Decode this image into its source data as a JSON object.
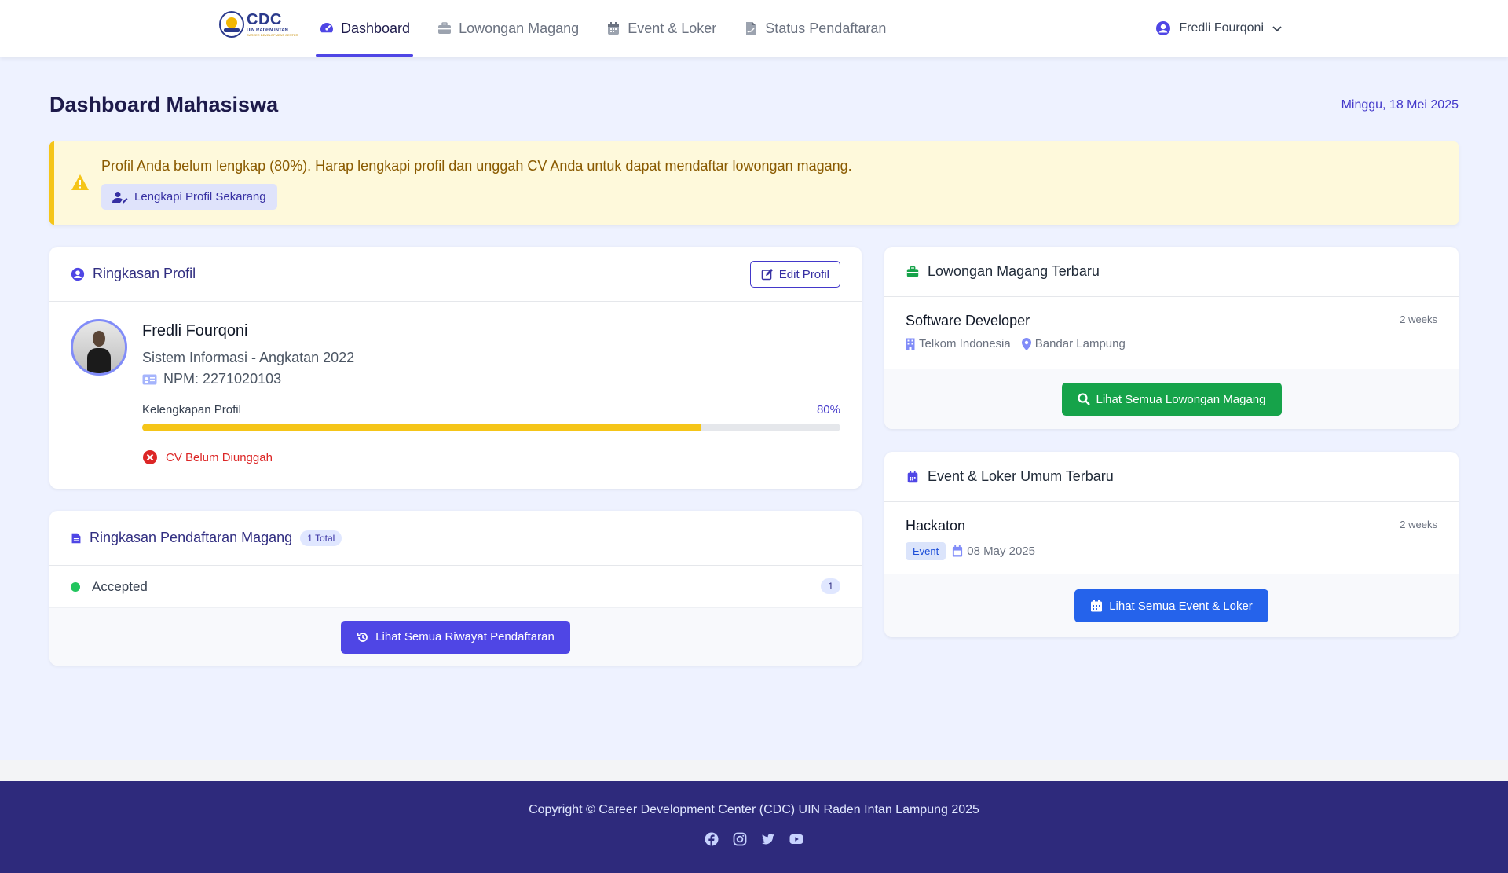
{
  "brand": {
    "name": "CDC",
    "sub": "UIN RADEN INTAN",
    "tagline": "CAREER DEVELOPMENT CENTER"
  },
  "nav": {
    "items": [
      {
        "label": "Dashboard",
        "icon": "gauge-icon",
        "active": true
      },
      {
        "label": "Lowongan Magang",
        "icon": "briefcase-icon"
      },
      {
        "label": "Event & Loker",
        "icon": "calendar-icon"
      },
      {
        "label": "Status Pendaftaran",
        "icon": "file-signature-icon"
      }
    ],
    "user": "Fredli Fourqoni"
  },
  "page": {
    "title": "Dashboard Mahasiswa",
    "date": "Minggu, 18 Mei 2025"
  },
  "alert": {
    "text": "Profil Anda belum lengkap (80%). Harap lengkapi profil dan unggah CV Anda untuk dapat mendaftar lowongan magang.",
    "button": "Lengkapi Profil Sekarang"
  },
  "profile": {
    "title": "Ringkasan Profil",
    "edit_label": "Edit Profil",
    "name": "Fredli Fourqoni",
    "program": "Sistem Informasi - Angkatan 2022",
    "npm": "NPM: 2271020103",
    "completeness_label": "Kelengkapan Profil",
    "completeness_text": "80%",
    "completeness": 0.8,
    "cv_status": "CV Belum Diunggah"
  },
  "registration": {
    "title": "Ringkasan Pendaftaran Magang",
    "total_badge": "1 Total",
    "rows": [
      {
        "label": "Accepted",
        "count": "1"
      }
    ],
    "button": "Lihat Semua Riwayat Pendaftaran"
  },
  "internships": {
    "title": "Lowongan Magang Terbaru",
    "items": [
      {
        "title": "Software Developer",
        "company": "Telkom Indonesia",
        "location": "Bandar Lampung",
        "time": "2 weeks"
      }
    ],
    "button": "Lihat Semua Lowongan Magang"
  },
  "events": {
    "title": "Event & Loker Umum Terbaru",
    "items": [
      {
        "title": "Hackaton",
        "tag": "Event",
        "date": "08 May 2025",
        "time": "2 weeks"
      }
    ],
    "button": "Lihat Semua Event & Loker"
  },
  "footer": {
    "copyright": "Copyright © Career Development Center (CDC) UIN Raden Intan Lampung 2025",
    "socials": [
      "facebook-icon",
      "instagram-icon",
      "twitter-icon",
      "youtube-icon"
    ]
  },
  "colors": {
    "primary": "#4f46e5",
    "navy": "#2e2a7c",
    "warning": "#f5c518",
    "success": "#16a34a",
    "info": "#2563eb",
    "danger": "#dc2626"
  }
}
